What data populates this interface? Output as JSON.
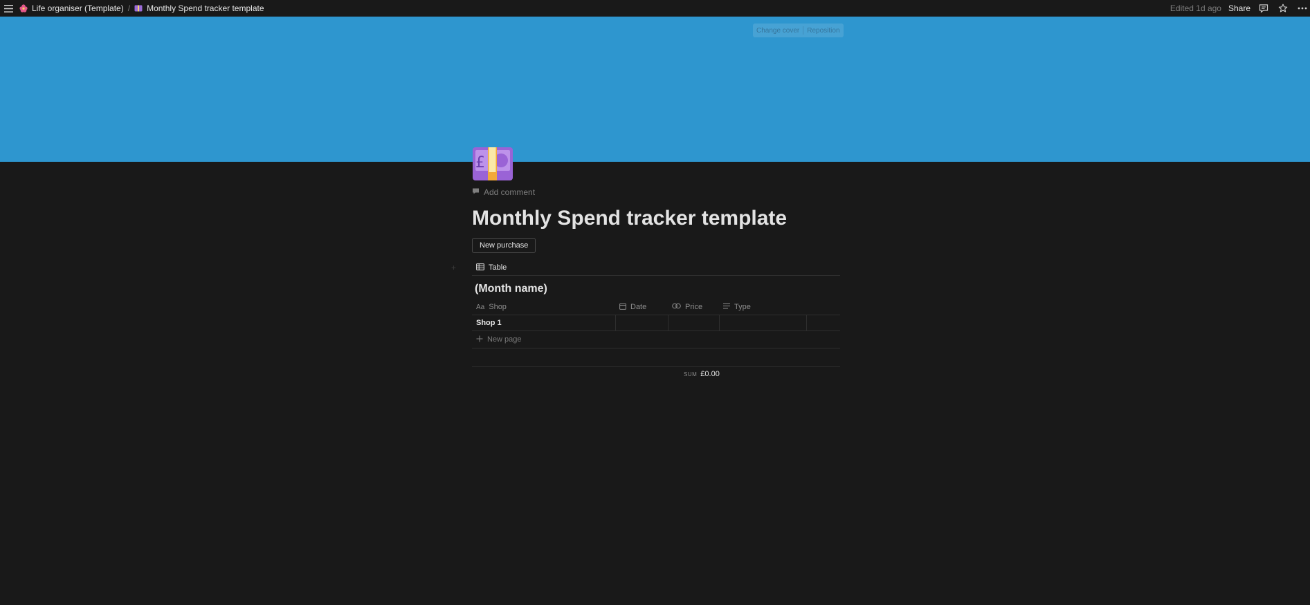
{
  "topbar": {
    "breadcrumbs": [
      {
        "label": "Life organiser (Template)"
      },
      {
        "label": "Monthly Spend tracker template"
      }
    ],
    "separator": "/",
    "edited": "Edited 1d ago",
    "share_label": "Share"
  },
  "cover": {
    "color": "#2e96cf",
    "change_cover_label": "Change cover",
    "reposition_label": "Reposition"
  },
  "page": {
    "add_comment_label": "Add comment",
    "title": "Monthly Spend tracker template",
    "new_purchase_label": "New purchase"
  },
  "database": {
    "view_tab_label": "Table",
    "group_title": "(Month name)",
    "columns": [
      {
        "icon": "text-icon",
        "label": "Shop"
      },
      {
        "icon": "calendar-icon",
        "label": "Date"
      },
      {
        "icon": "formula-icon",
        "label": "Price"
      },
      {
        "icon": "lines-icon",
        "label": "Type"
      }
    ],
    "rows": [
      {
        "shop": "Shop 1",
        "date": "",
        "price": "",
        "type": ""
      }
    ],
    "new_page_label": "New page",
    "sum_label": "SUM",
    "sum_value": "£0.00"
  }
}
